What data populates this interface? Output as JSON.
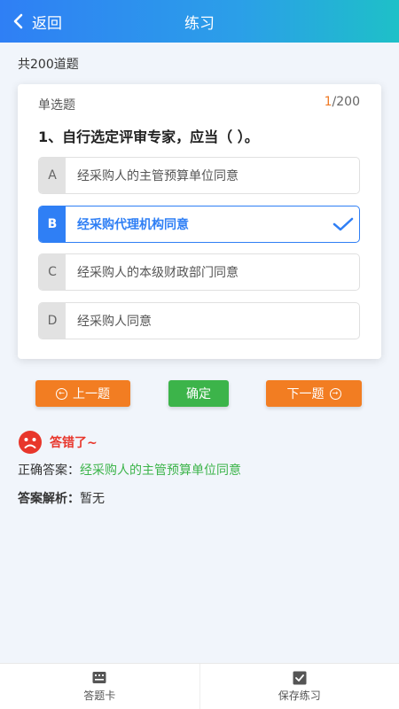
{
  "header": {
    "back_label": "返回",
    "title": "练习"
  },
  "summary": {
    "total_text": "共200道题"
  },
  "question": {
    "type_label": "单选题",
    "progress_current": "1",
    "progress_total": "/200",
    "text": "1、自行选定评审专家，应当（ ）。",
    "options": [
      {
        "letter": "A",
        "text": "经采购人的主管预算单位同意",
        "selected": false
      },
      {
        "letter": "B",
        "text": "经采购代理机构同意",
        "selected": true
      },
      {
        "letter": "C",
        "text": "经采购人的本级财政部门同意",
        "selected": false
      },
      {
        "letter": "D",
        "text": "经采购人同意",
        "selected": false
      }
    ]
  },
  "buttons": {
    "prev_label": "上一题",
    "confirm_label": "确定",
    "next_label": "下一题"
  },
  "result": {
    "status_text": "答错了~",
    "answer_label": "正确答案：",
    "answer_value": "经采购人的主管预算单位同意",
    "analysis_label": "答案解析：",
    "analysis_value": "暂无"
  },
  "tabbar": {
    "answer_card_label": "答题卡",
    "save_label": "保存练习"
  },
  "colors": {
    "primary": "#2f7ff5",
    "orange": "#f27d22",
    "green": "#3cb44a",
    "red": "#e8362b"
  },
  "icons": [
    "chevron-left-icon",
    "checkmark-icon",
    "prev-arrow-icon",
    "next-arrow-icon",
    "sad-face-icon",
    "answer-card-icon",
    "save-check-icon"
  ]
}
